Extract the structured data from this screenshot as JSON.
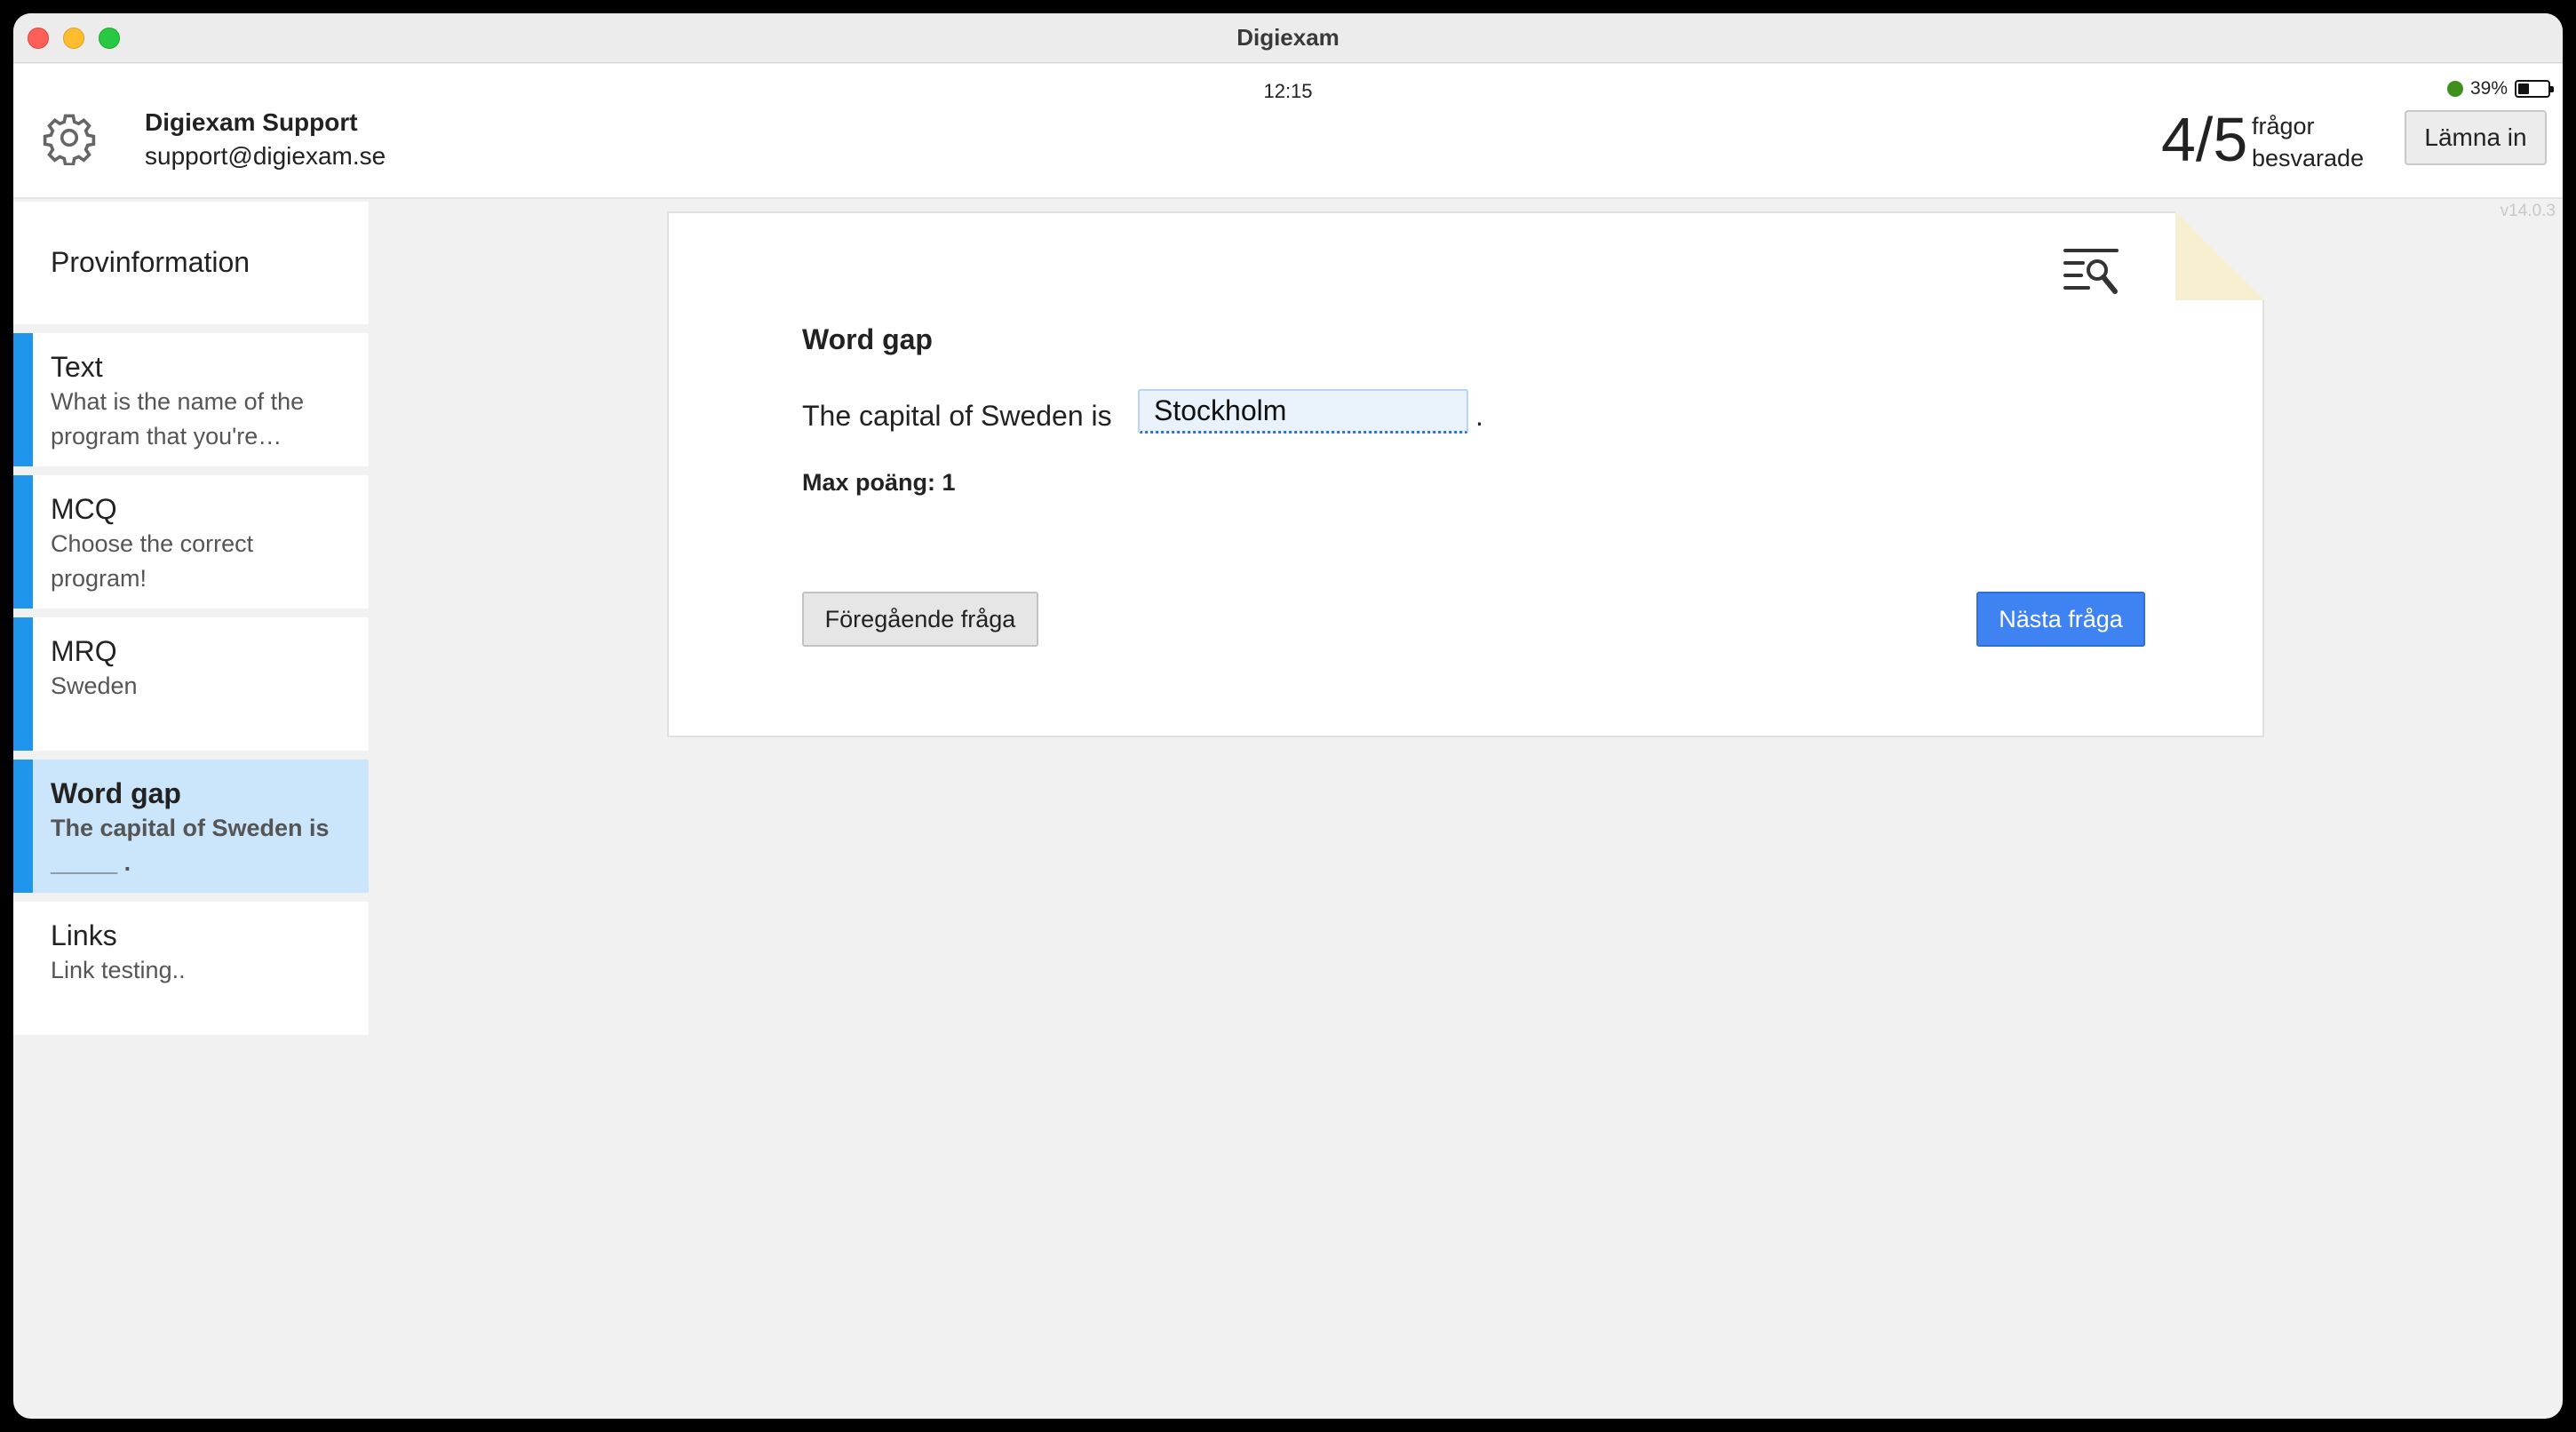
{
  "window": {
    "title": "Digiexam"
  },
  "status_bar": {
    "time": "12:15",
    "battery_percent": "39%",
    "battery_level": 0.39
  },
  "user": {
    "name": "Digiexam Support",
    "email": "support@digiexam.se"
  },
  "progress": {
    "count": "4/5",
    "label_line1": "frågor",
    "label_line2": "besvarade"
  },
  "header": {
    "submit_label": "Lämna in",
    "settings_icon": "gear-icon"
  },
  "version": "v14.0.3",
  "sidebar": {
    "info_label": "Provinformation",
    "items": [
      {
        "title": "Text",
        "subtitle": "What is the name of the program that you're…"
      },
      {
        "title": "MCQ",
        "subtitle": "Choose the correct program!"
      },
      {
        "title": "MRQ",
        "subtitle": "Sweden"
      },
      {
        "title": "Word gap",
        "subtitle": "The capital of Sweden is _____ .",
        "active": true
      },
      {
        "title": "Links",
        "subtitle": "Link testing.."
      }
    ]
  },
  "question": {
    "title": "Word gap",
    "text_before": "The capital of Sweden is",
    "answer": "Stockholm",
    "text_after": ".",
    "max_points": "Max poäng: 1",
    "tools_icon": "text-search-icon"
  },
  "nav": {
    "prev_label": "Föregående fråga",
    "next_label": "Nästa fråga"
  },
  "colors": {
    "accent": "#3f83f3",
    "sidebar_marker": "#1f95ec",
    "active_item": "#cbe5fa"
  }
}
